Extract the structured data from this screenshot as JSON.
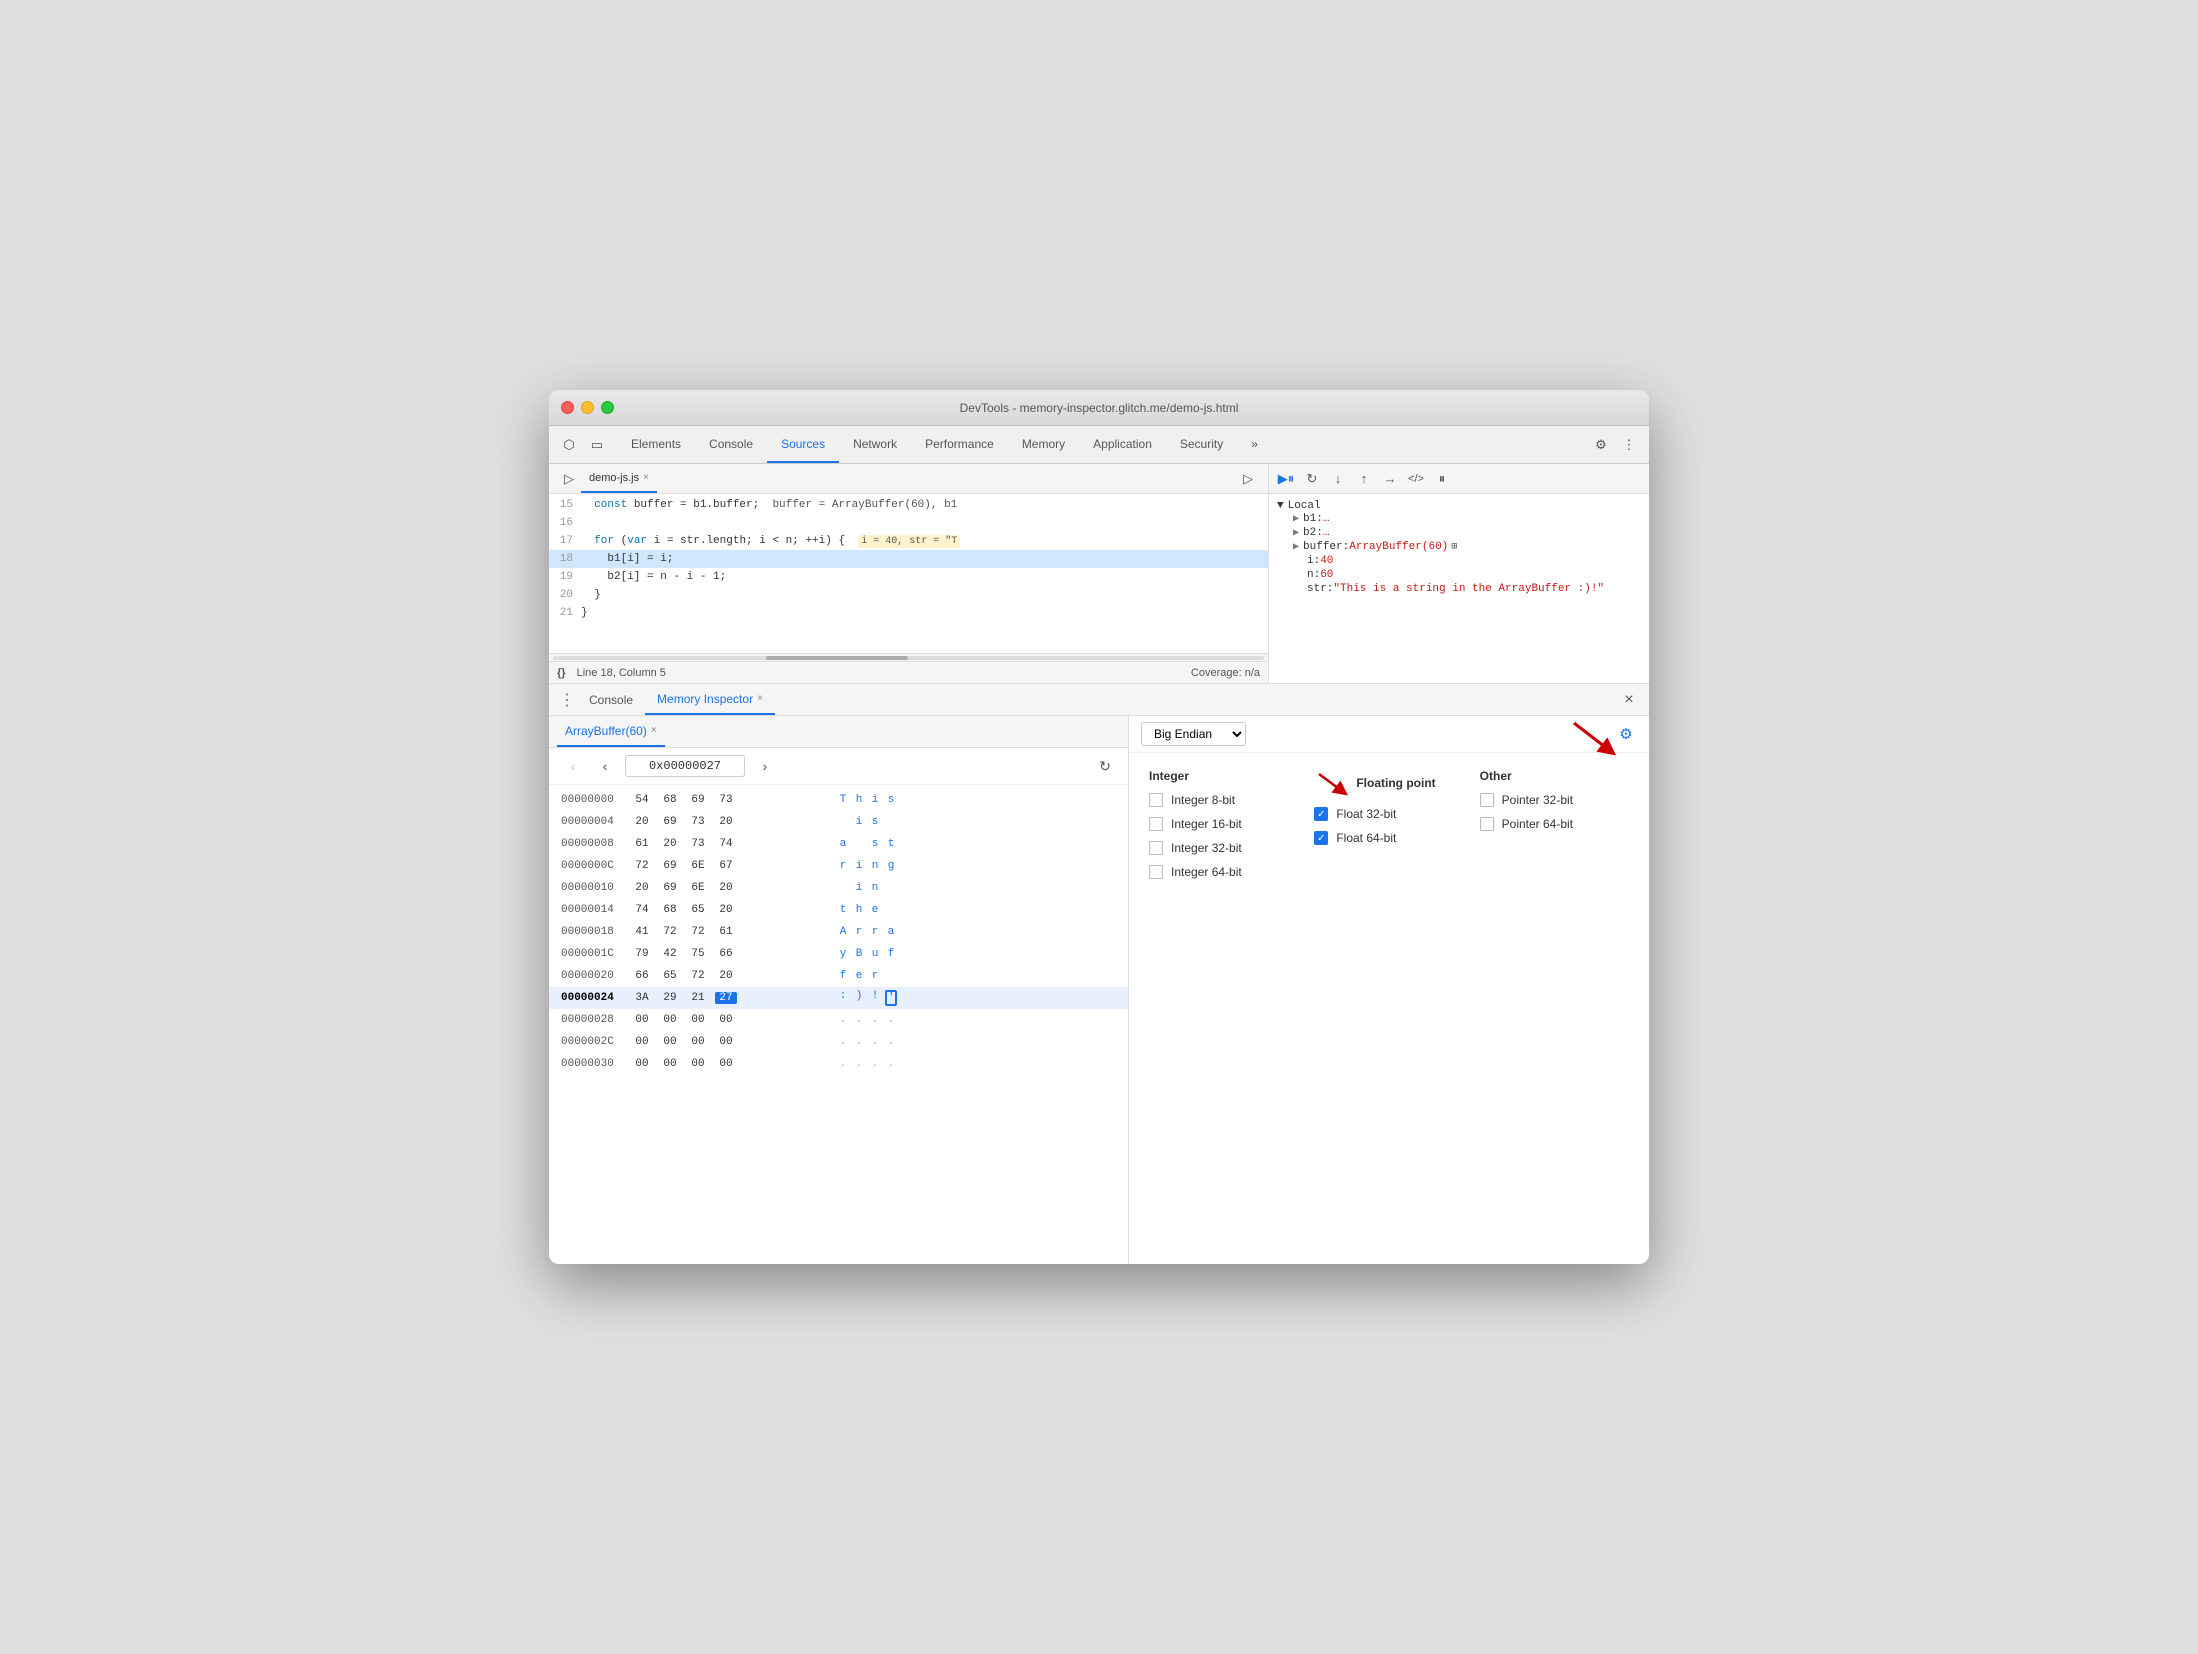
{
  "window": {
    "title": "DevTools - memory-inspector.glitch.me/demo-js.html"
  },
  "traffic_lights": {
    "close": "close",
    "minimize": "minimize",
    "maximize": "maximize"
  },
  "devtools_tabs": {
    "items": [
      {
        "label": "Elements",
        "active": false
      },
      {
        "label": "Console",
        "active": false
      },
      {
        "label": "Sources",
        "active": true
      },
      {
        "label": "Network",
        "active": false
      },
      {
        "label": "Performance",
        "active": false
      },
      {
        "label": "Memory",
        "active": false
      },
      {
        "label": "Application",
        "active": false
      },
      {
        "label": "Security",
        "active": false
      }
    ],
    "more_label": "»"
  },
  "source": {
    "filename": "demo-js.js",
    "lines": [
      {
        "num": "15",
        "content": "  const buffer = b1.buffer;  buffer = ArrayBuffer(60), b1",
        "highlighted": false
      },
      {
        "num": "16",
        "content": "",
        "highlighted": false
      },
      {
        "num": "17",
        "content": "  for (var i = str.length; i < n; ++i) {",
        "highlighted": false,
        "inline_val": "i = 40, str = \"T"
      },
      {
        "num": "18",
        "content": "    b1[i] = i;",
        "highlighted": true
      },
      {
        "num": "19",
        "content": "    b2[i] = n - i - 1;",
        "highlighted": false
      },
      {
        "num": "20",
        "content": "  }",
        "highlighted": false
      },
      {
        "num": "21",
        "content": "}",
        "highlighted": false
      }
    ],
    "status": "Line 18, Column 5",
    "coverage": "Coverage: n/a"
  },
  "scope": {
    "toolbar_btns": [
      "▶▐",
      "↻",
      "↓",
      "↑",
      "→",
      "<//>",
      "⏸"
    ],
    "local_label": "Local",
    "items": [
      {
        "key": "b1:",
        "val": "…",
        "expand": true
      },
      {
        "key": "b2:",
        "val": "…",
        "expand": true
      },
      {
        "key": "buffer:",
        "val": "ArrayBuffer(60)",
        "has_icon": true,
        "expand": true
      },
      {
        "key": "i:",
        "val": "40",
        "expand": false
      },
      {
        "key": "n:",
        "val": "60",
        "expand": false
      },
      {
        "key": "str:",
        "val": "\"This is a string in the ArrayBuffer :)!\"",
        "expand": false
      }
    ]
  },
  "bottom_tabs": {
    "dots": "⋮",
    "items": [
      {
        "label": "Console",
        "active": false
      },
      {
        "label": "Memory Inspector",
        "active": true,
        "closeable": true
      }
    ],
    "close_icon": "×"
  },
  "memory": {
    "arraybuffer_tab": "ArrayBuffer(60)",
    "nav": {
      "back": "‹",
      "forward": "›",
      "address": "0x00000027",
      "refresh": "↻"
    },
    "rows": [
      {
        "addr": "00000000",
        "bytes": [
          "54",
          "68",
          "69",
          "73"
        ],
        "chars": [
          "T",
          "h",
          "i",
          "s"
        ],
        "selected": false
      },
      {
        "addr": "00000004",
        "bytes": [
          "20",
          "69",
          "73",
          "20"
        ],
        "chars": [
          "",
          "i",
          "s",
          ""
        ],
        "selected": false
      },
      {
        "addr": "00000008",
        "bytes": [
          "61",
          "20",
          "73",
          "74"
        ],
        "chars": [
          "a",
          "",
          "s",
          "t"
        ],
        "selected": false
      },
      {
        "addr": "0000000C",
        "bytes": [
          "72",
          "69",
          "6E",
          "67"
        ],
        "chars": [
          "r",
          "i",
          "n",
          "g"
        ],
        "selected": false
      },
      {
        "addr": "00000010",
        "bytes": [
          "20",
          "69",
          "6E",
          "20"
        ],
        "chars": [
          "",
          "i",
          "n",
          ""
        ],
        "selected": false
      },
      {
        "addr": "00000014",
        "bytes": [
          "74",
          "68",
          "65",
          "20"
        ],
        "chars": [
          "t",
          "h",
          "e",
          ""
        ],
        "selected": false
      },
      {
        "addr": "00000018",
        "bytes": [
          "41",
          "72",
          "72",
          "61"
        ],
        "chars": [
          "A",
          "r",
          "r",
          "a"
        ],
        "selected": false
      },
      {
        "addr": "0000001C",
        "bytes": [
          "79",
          "42",
          "75",
          "66"
        ],
        "chars": [
          "y",
          "B",
          "u",
          "f"
        ],
        "selected": false
      },
      {
        "addr": "00000020",
        "bytes": [
          "66",
          "65",
          "72",
          "20"
        ],
        "chars": [
          "f",
          "e",
          "r",
          ""
        ],
        "selected": false
      },
      {
        "addr": "00000024",
        "bytes": [
          "3A",
          "29",
          "21",
          "27"
        ],
        "chars": [
          ":",
          ")",
          "!",
          "'"
        ],
        "selected": true,
        "highlighted_byte": 3
      },
      {
        "addr": "00000028",
        "bytes": [
          "00",
          "00",
          "00",
          "00"
        ],
        "chars": [
          ".",
          ".",
          ".",
          "."
        ],
        "selected": false,
        "dot": true
      },
      {
        "addr": "0000002C",
        "bytes": [
          "00",
          "00",
          "00",
          "00"
        ],
        "chars": [
          ".",
          ".",
          ".",
          "."
        ],
        "selected": false,
        "dot": true
      },
      {
        "addr": "00000030",
        "bytes": [
          "00",
          "00",
          "00",
          "00"
        ],
        "chars": [
          ".",
          ".",
          ".",
          "."
        ],
        "selected": false,
        "dot": true
      }
    ]
  },
  "inspector": {
    "endian": "Big Endian",
    "gear_icon": "⚙",
    "integer_label": "Integer",
    "float_label": "Floating point",
    "other_label": "Other",
    "integer_options": [
      {
        "label": "Integer 8-bit",
        "checked": false
      },
      {
        "label": "Integer 16-bit",
        "checked": false
      },
      {
        "label": "Integer 32-bit",
        "checked": false
      },
      {
        "label": "Integer 64-bit",
        "checked": false
      }
    ],
    "float_options": [
      {
        "label": "Float 32-bit",
        "checked": true
      },
      {
        "label": "Float 64-bit",
        "checked": true
      }
    ],
    "other_options": [
      {
        "label": "Pointer 32-bit",
        "checked": false
      },
      {
        "label": "Pointer 64-bit",
        "checked": false
      }
    ]
  }
}
